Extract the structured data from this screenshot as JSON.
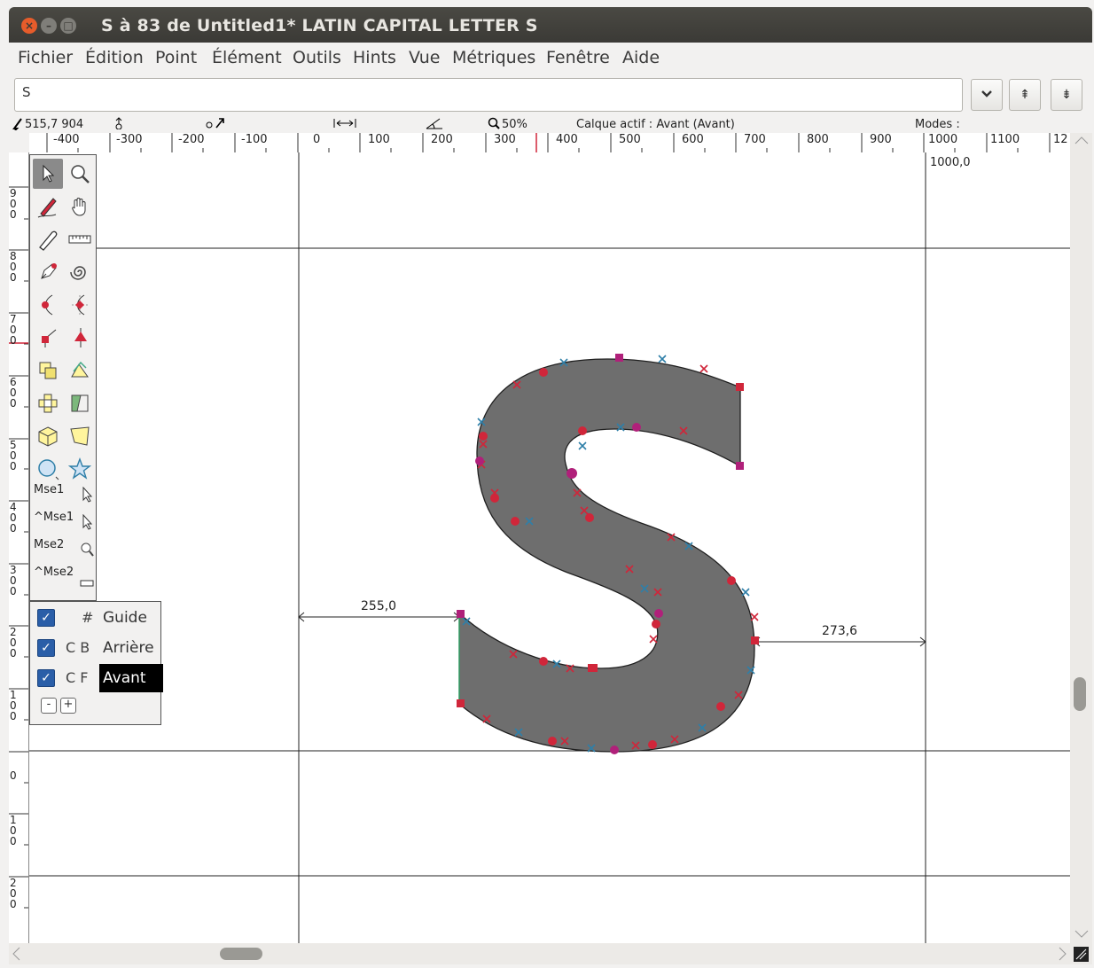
{
  "window": {
    "title": "S à 83 de Untitled1* LATIN CAPITAL LETTER S",
    "close_glyph": "×",
    "minimize_glyph": "–",
    "maximize_glyph": "□"
  },
  "menu": [
    "Fichier",
    "Édition",
    "Point",
    "Élément",
    "Outils",
    "Hints",
    "Vue",
    "Métriques",
    "Fenêtre",
    "Aide"
  ],
  "glyph_field": {
    "value": "S",
    "dropdown_icon": "chevron-down-icon",
    "btn_vertical_up_glyph": "⇞",
    "btn_vertical_down_glyph": "⇟"
  },
  "infobar": {
    "coords": "515,7 904",
    "zoom": "50%",
    "active_layer": "Calque actif : Avant (Avant)",
    "modes_label": "Modes :"
  },
  "ruler_top_labels": [
    "-400",
    "-300",
    "-200",
    "-100",
    "0",
    "100",
    "200",
    "300",
    "400",
    "500",
    "600",
    "700",
    "800",
    "900",
    "1000",
    "1100",
    "12"
  ],
  "ruler_left_labels": [
    "9\n0\n0",
    "8\n0\n0",
    "7\n0\n0",
    "6\n0\n0",
    "5\n0\n0",
    "4\n0\n0",
    "3\n0\n0",
    "2\n0\n0",
    "1\n0\n0",
    "0",
    "1\n0\n0",
    "2\n0\n0"
  ],
  "canvas": {
    "width_label": "1000,0",
    "left_bearing": "255,0",
    "right_bearing": "273,6",
    "glyph_fill": "#6e6e6e"
  },
  "toolbox": {
    "tools": [
      "pointer-icon",
      "magnify-icon",
      "freehand-icon",
      "scroll-hand-icon",
      "knife-icon",
      "ruler-icon",
      "pen-icon",
      "spiro-icon",
      "curve-point-icon",
      "hv-curve-point-icon",
      "corner-point-icon",
      "tangent-point-icon",
      "scale-icon",
      "rotate-icon",
      "flip-icon",
      "skew-icon",
      "perspective-3d-icon",
      "perspective-icon",
      "ellipse-icon",
      "star-icon"
    ],
    "mouse_labels": [
      "Mse1",
      "^Mse1",
      "Mse2",
      "^Mse2"
    ]
  },
  "layers": [
    {
      "flags": "#",
      "name": "Guide",
      "checked": true,
      "active": false
    },
    {
      "flags": "C B",
      "name": "Arrière",
      "checked": true,
      "active": false
    },
    {
      "flags": "C F",
      "name": "Avant",
      "checked": true,
      "active": true
    }
  ],
  "layer_buttons": {
    "remove": "-",
    "add": "+"
  },
  "colors": {
    "accent": "#e65c2b",
    "checkbox": "#2a5ea8",
    "point_red": "#d0263a",
    "point_blue": "#2f7fa8",
    "point_magenta": "#b0207a"
  }
}
